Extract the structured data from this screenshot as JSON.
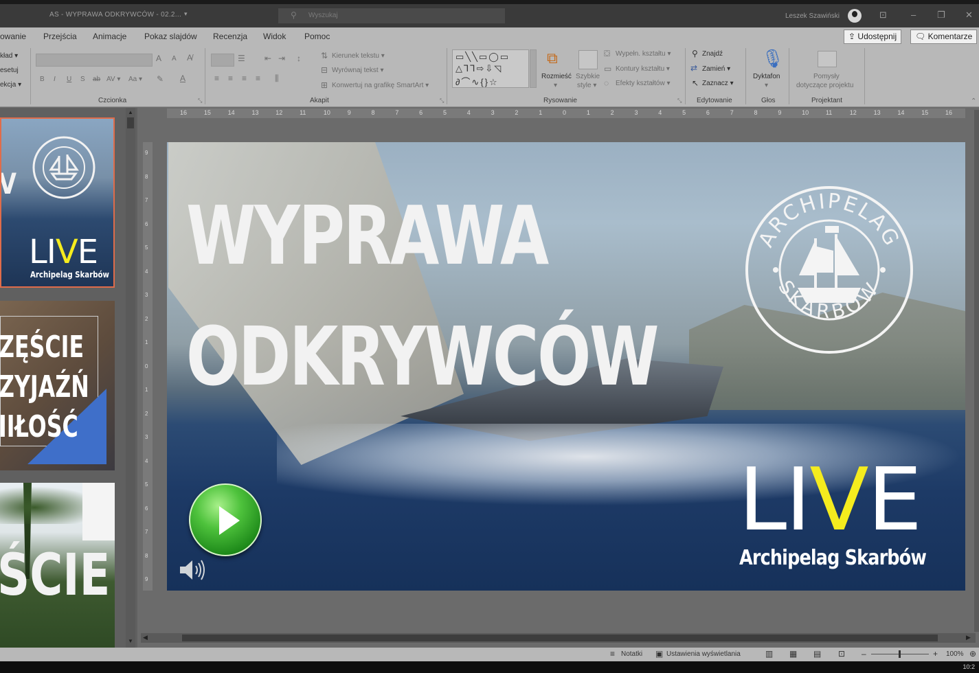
{
  "window": {
    "title": "AS - WYPRAWA ODKRYWCÓW - 02.2...",
    "search_placeholder": "Wyszukaj",
    "user_name": "Leszek Szawiński",
    "minimize": "–",
    "restore": "❐",
    "close": "✕",
    "ribbon_display": "⊡"
  },
  "tabs": [
    {
      "label": "owanie"
    },
    {
      "label": "Przejścia"
    },
    {
      "label": "Animacje"
    },
    {
      "label": "Pokaz slajdów"
    },
    {
      "label": "Recenzja"
    },
    {
      "label": "Widok"
    },
    {
      "label": "Pomoc"
    }
  ],
  "share_button": "Udostępnij",
  "comments_button": "Komentarze",
  "ribbon": {
    "slides_group": [
      "kład ▾",
      "esetuj",
      "ekcja ▾"
    ],
    "font_group_label": "Czcionka",
    "font_size_labels": [
      "A",
      "A"
    ],
    "font_format_glyphs": [
      "B",
      "I",
      "U",
      "S",
      "ab",
      "AV ▾",
      "Aa ▾"
    ],
    "paragraph_group_label": "Akapit",
    "text_direction": "Kierunek tekstu ▾",
    "align_text": "Wyrównaj tekst ▾",
    "convert_smartart": "Konwertuj na grafikę SmartArt ▾",
    "drawing_group_label": "Rysowanie",
    "arrange": "Rozmieść",
    "quick_styles": [
      "Szybkie",
      "style ▾"
    ],
    "shape_fill": "Wypełn. kształtu ▾",
    "shape_outline": "Kontury kształtu ▾",
    "shape_effects": "Efekty kształtów ▾",
    "editing_group_label": "Edytowanie",
    "find": "Znajdź",
    "replace": "Zamień ▾",
    "select": "Zaznacz ▾",
    "voice_group_label": "Głos",
    "dictate": "Dyktafon",
    "designer_group_label": "Projektant",
    "design_ideas": [
      "Pomysły",
      "dotyczące projektu"
    ]
  },
  "thumbnails": [
    {
      "text_main": "LIVE",
      "text_sub": "Archipelag Skarbów",
      "text_partial": "V"
    },
    {
      "lines": [
        "ZĘŚCIE",
        "ZYJAŹŃ",
        "IIŁOŚĆ"
      ]
    },
    {
      "text_main": "ŚCIE"
    }
  ],
  "ruler_h": [
    "16",
    "15",
    "14",
    "13",
    "12",
    "11",
    "10",
    "9",
    "8",
    "7",
    "6",
    "5",
    "4",
    "3",
    "2",
    "1",
    "0",
    "1",
    "2",
    "3",
    "4",
    "5",
    "6",
    "7",
    "8",
    "9",
    "10",
    "11",
    "12",
    "13",
    "14",
    "15",
    "16"
  ],
  "ruler_v": [
    "9",
    "8",
    "7",
    "6",
    "5",
    "4",
    "3",
    "2",
    "1",
    "0",
    "1",
    "2",
    "3",
    "4",
    "5",
    "6",
    "7",
    "8",
    "9"
  ],
  "slide": {
    "title_line1": "WYPRAWA",
    "title_line2": "ODKRYWCÓW",
    "seal_top": "ARCHIPELAG",
    "seal_bottom": "SKARBÓW",
    "live_l": "LI",
    "live_v": "V",
    "live_e": "E",
    "live_sub": "Archipelag Skarbów",
    "colors": {
      "accent_yellow": "#f5ec1e",
      "play_green": "#2faa22"
    }
  },
  "status": {
    "notes": "Notatki",
    "display_settings": "Ustawienia wyświetlania",
    "zoom": "100%",
    "zoom_minus": "–",
    "zoom_plus": "+",
    "clock": "10:2"
  }
}
